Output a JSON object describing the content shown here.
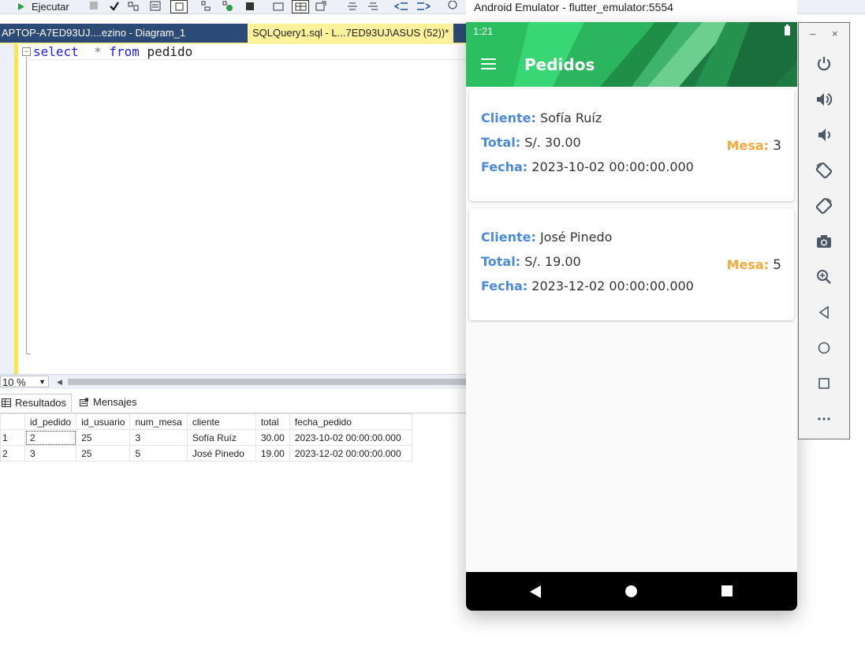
{
  "ssms": {
    "toolbar": {
      "execute_label": "Ejecutar"
    },
    "tabs": [
      {
        "label": "APTOP-A7ED93UJ....ezino - Diagram_1"
      },
      {
        "label": "SQLQuery1.sql - L...7ED93UJ\\ASUS (52))*"
      }
    ],
    "query": {
      "kw_select": "select",
      "op_star": "*",
      "kw_from": "from",
      "table": "pedido"
    },
    "zoom": "10 %",
    "result_tabs": {
      "results": "Resultados",
      "messages": "Mensajes"
    },
    "grid": {
      "columns": [
        "id_pedido",
        "id_usuario",
        "num_mesa",
        "cliente",
        "total",
        "fecha_pedido"
      ],
      "rows": [
        {
          "n": "1",
          "cells": [
            "2",
            "25",
            "3",
            "Sofía Ruíz",
            "30.00",
            "2023-10-02 00:00:00.000"
          ]
        },
        {
          "n": "2",
          "cells": [
            "3",
            "25",
            "5",
            "José Pinedo",
            "19.00",
            "2023-12-02 00:00:00.000"
          ]
        }
      ]
    }
  },
  "emulator": {
    "window_title": "Android Emulator - flutter_emulator:5554",
    "status_time": "1:21",
    "app_title": "Pedidos",
    "labels": {
      "cliente": "Cliente:",
      "total": "Total:",
      "fecha": "Fecha:",
      "mesa": "Mesa:"
    },
    "orders": [
      {
        "cliente": "Sofía Ruíz",
        "total": "S/. 30.00",
        "fecha": "2023-10-02 00:00:00.000",
        "mesa": "3"
      },
      {
        "cliente": "José Pinedo",
        "total": "S/. 19.00",
        "fecha": "2023-12-02 00:00:00.000",
        "mesa": "5"
      }
    ],
    "side_controls": [
      "power-icon",
      "volume-up-icon",
      "volume-down-icon",
      "rotate-left-icon",
      "rotate-right-icon",
      "camera-icon",
      "zoom-icon",
      "back-icon",
      "home-icon",
      "overview-icon",
      "more-icon"
    ]
  },
  "colors": {
    "app_green": "#1d7a43",
    "label_blue": "#4a89dc",
    "mesa_orange": "#f5a93a",
    "editor_keyword": "#1a1aff"
  }
}
